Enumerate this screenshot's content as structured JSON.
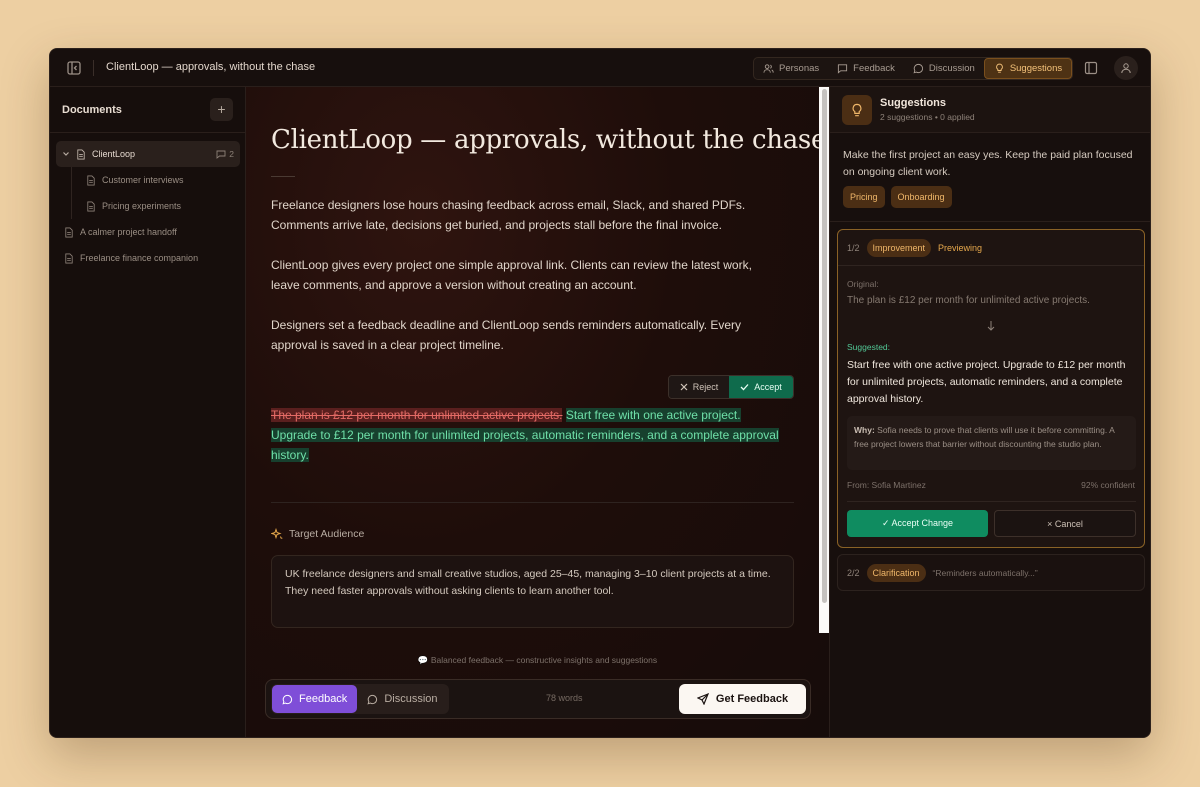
{
  "window": {
    "title": "ClientLoop — approvals, without the chase"
  },
  "nav": {
    "items": [
      {
        "label": "Personas",
        "icon": "users-icon",
        "active": false
      },
      {
        "label": "Feedback",
        "icon": "message-square-icon",
        "active": false
      },
      {
        "label": "Discussion",
        "icon": "message-circle-icon",
        "active": false
      },
      {
        "label": "Suggestions",
        "icon": "lightbulb-icon",
        "active": true
      }
    ]
  },
  "sidebar": {
    "title": "Documents",
    "add_label": "+",
    "root": {
      "label": "ClientLoop",
      "comment_count": "2"
    },
    "children": [
      {
        "label": "Customer interviews"
      },
      {
        "label": "Pricing experiments"
      }
    ],
    "others": [
      {
        "label": "A calmer project handoff"
      },
      {
        "label": "Freelance finance companion"
      }
    ]
  },
  "editor": {
    "title": "ClientLoop — approvals, without the chase",
    "paragraphs": [
      "Freelance designers lose hours chasing feedback across email, Slack, and shared PDFs. Comments arrive late, decisions get buried, and projects stall before the final invoice.",
      "ClientLoop gives every project one simple approval link. Clients can review the latest work, leave comments, and approve a version without creating an account.",
      "Designers set a feedback deadline and ClientLoop sends reminders automatically. Every approval is saved in a clear project timeline."
    ],
    "change": {
      "reject_label": "Reject",
      "accept_label": "Accept",
      "deleted": "The plan is £12 per month for unlimited active projects.",
      "inserted": "Start free with one active project. Upgrade to £12 per month for unlimited projects, automatic reminders, and a complete approval history."
    },
    "target_audience": {
      "label": "Target Audience",
      "text": "UK freelance designers and small creative studios, aged 25–45, managing 3–10 client projects at a time. They need faster approvals without asking clients to learn another tool."
    },
    "mode_note": "Balanced feedback — constructive insights and suggestions",
    "mode_note_icon": "💬",
    "bottom": {
      "feedback_label": "Feedback",
      "discussion_label": "Discussion",
      "word_count": "78 words",
      "get_feedback_label": "Get Feedback"
    }
  },
  "panel": {
    "title": "Suggestions",
    "subtitle": "2 suggestions • 0 applied",
    "description": "Make the first project an easy yes. Keep the paid plan focused on ongoing client work.",
    "tags": [
      "Pricing",
      "Onboarding"
    ],
    "card1": {
      "index": "1/2",
      "type": "Improvement",
      "status": "Previewing",
      "original_label": "Original:",
      "original_text": "The plan is £12 per month for unlimited active projects.",
      "suggested_label": "Suggested:",
      "suggested_text": "Start free with one active project. Upgrade to £12 per month for unlimited projects, automatic reminders, and a complete approval history.",
      "why_label": "Why:",
      "why_text": "Sofia needs to prove that clients will use it before committing. A free project lowers that barrier without discounting the studio plan.",
      "from": "From: Sofia Martinez",
      "confidence": "92% confident",
      "accept_label": "✓ Accept Change",
      "cancel_label": "× Cancel"
    },
    "card2": {
      "index": "2/2",
      "type": "Clarification",
      "quote": "“Reminders automatically...”"
    }
  },
  "colors": {
    "accent": "#f0b76a",
    "accept_green": "#0f8c60",
    "feedback_purple": "#7f4ed8",
    "deleted_red": "#e46b66",
    "inserted_green": "#6fe0a9"
  }
}
